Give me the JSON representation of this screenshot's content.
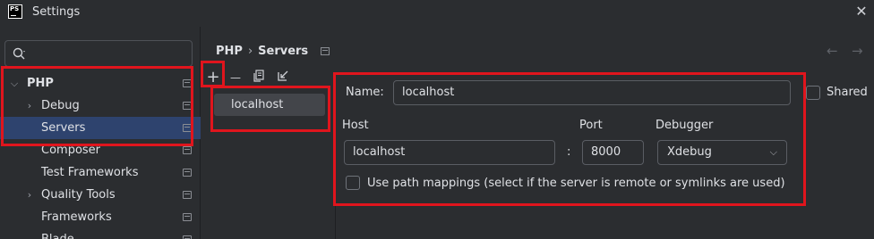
{
  "window": {
    "app_icon_text": "PS",
    "title": "Settings",
    "close_glyph": "✕"
  },
  "search": {
    "value": "",
    "icon": "search-icon"
  },
  "tree": [
    {
      "label": "PHP",
      "bold": true,
      "expanded": true,
      "level": 0,
      "selected": false
    },
    {
      "label": "Debug",
      "bold": false,
      "expanded": false,
      "level": 1,
      "selected": false
    },
    {
      "label": "Servers",
      "bold": false,
      "level": 1,
      "selected": true
    },
    {
      "label": "Composer",
      "bold": false,
      "level": 1,
      "selected": false
    },
    {
      "label": "Test Frameworks",
      "bold": false,
      "level": 1,
      "selected": false
    },
    {
      "label": "Quality Tools",
      "bold": false,
      "expanded": false,
      "level": 1,
      "selected": false
    },
    {
      "label": "Frameworks",
      "bold": false,
      "level": 1,
      "selected": false
    },
    {
      "label": "Blade",
      "bold": false,
      "level": 1,
      "selected": false
    }
  ],
  "breadcrumb": {
    "parent": "PHP",
    "separator": "›",
    "current": "Servers"
  },
  "nav": {
    "back": "←",
    "forward": "→"
  },
  "toolbar": {
    "add": "+",
    "remove": "—",
    "copy_icon": "copy-icon",
    "import_icon": "import-icon"
  },
  "servers": [
    {
      "name": "localhost",
      "selected": true
    }
  ],
  "form": {
    "name_label": "Name:",
    "name_value": "localhost",
    "shared_label": "Shared",
    "shared_checked": false,
    "host_label": "Host",
    "host_value": "localhost",
    "colon": ":",
    "port_label": "Port",
    "port_value": "8000",
    "debugger_label": "Debugger",
    "debugger_value": "Xdebug",
    "path_mappings_label": "Use path mappings (select if the server is remote or symlinks are used)",
    "path_mappings_checked": false
  },
  "colors": {
    "highlight": "#e0151d",
    "selection": "#2e436e",
    "background": "#2b2d30"
  }
}
